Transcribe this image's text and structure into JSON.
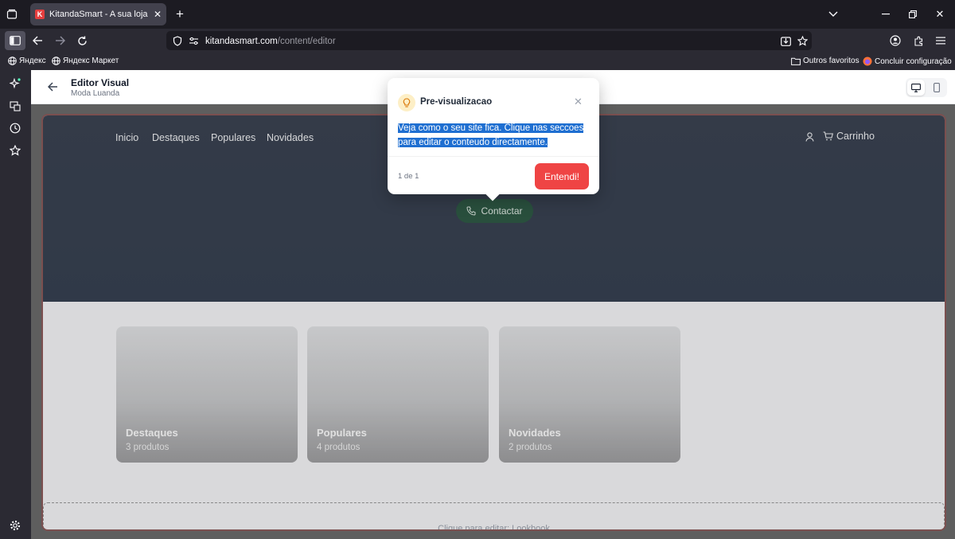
{
  "browser": {
    "tab": {
      "title": "KitandaSmart - A sua loja online",
      "favicon_letter": "K"
    },
    "url": {
      "host": "kitandasmart.com",
      "path": "/content/editor"
    },
    "bookmarks": [
      {
        "label": "Яндекс"
      },
      {
        "label": "Яндекс Маркет"
      }
    ],
    "bookmarks_right": [
      {
        "label": "Outros favoritos"
      },
      {
        "label": "Concluir configuração"
      }
    ]
  },
  "editor": {
    "title": "Editor Visual",
    "subtitle": "Moda Luanda"
  },
  "store": {
    "nav": [
      "Inicio",
      "Destaques",
      "Populares",
      "Novidades"
    ],
    "cart_label": "Carrinho",
    "contact_label": "Contactar",
    "categories": [
      {
        "title": "Destaques",
        "count": "3 produtos"
      },
      {
        "title": "Populares",
        "count": "4 produtos"
      },
      {
        "title": "Novidades",
        "count": "2 produtos"
      }
    ],
    "lookbook_hint": "Clique para editar: Lookbook"
  },
  "popover": {
    "title": "Pre-visualizacao",
    "body_line1": "Veja como o seu site fica. Clique nas seccoes",
    "body_line2": "para editar o conteudo directamente.",
    "counter": "1 de 1",
    "button": "Entendi!"
  },
  "colors": {
    "accent": "#ef4444",
    "hero": "#3a4252",
    "contact_button": "#2f5a46"
  }
}
